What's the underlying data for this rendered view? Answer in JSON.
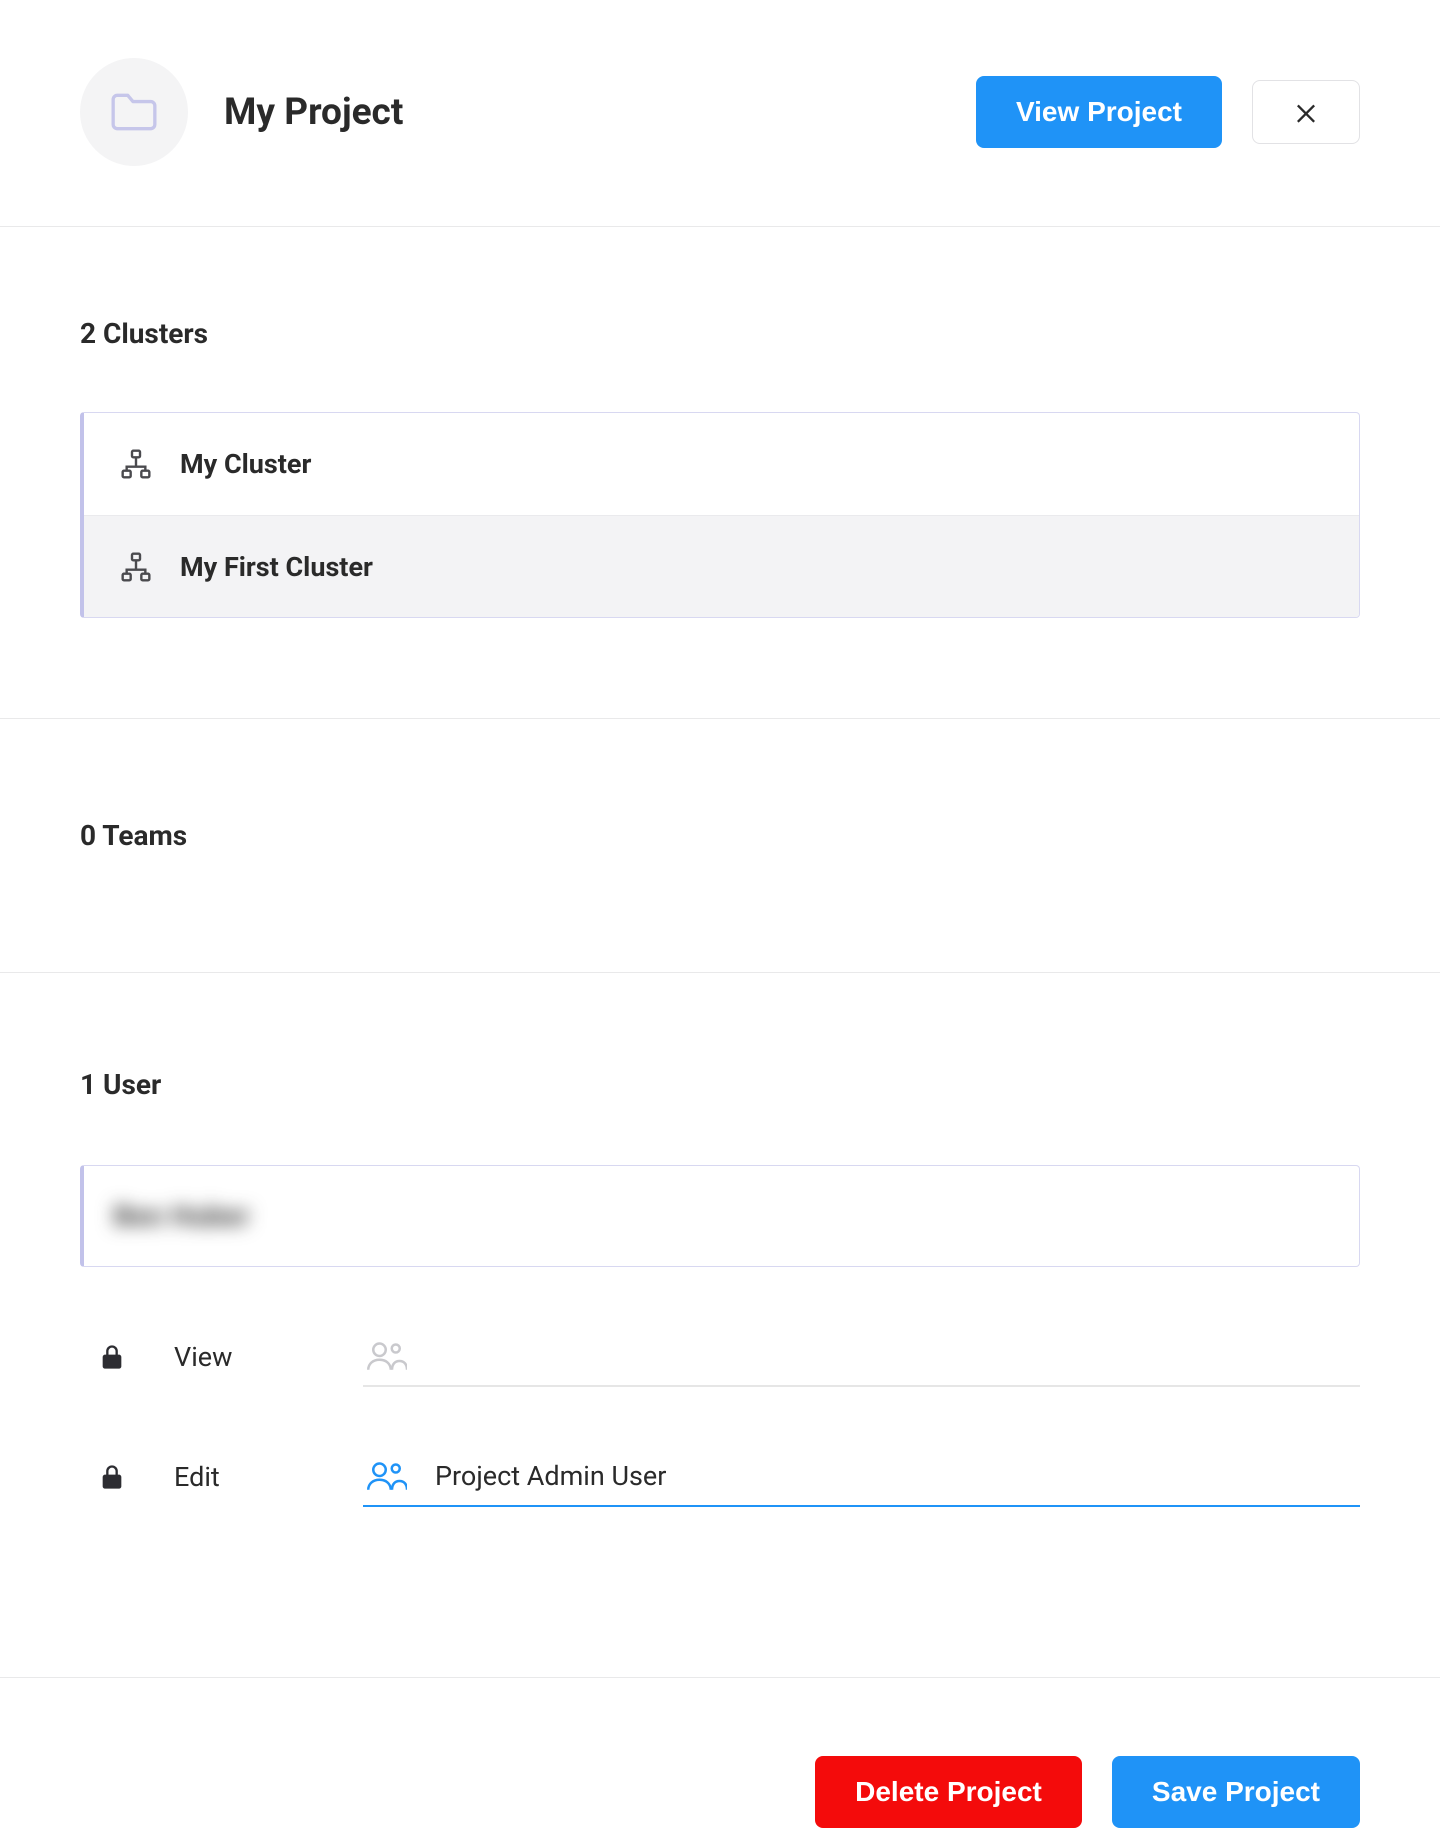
{
  "header": {
    "title": "My Project",
    "view_button": "View Project",
    "close_label": "Close"
  },
  "clusters": {
    "heading": "2 Clusters",
    "items": [
      {
        "name": "My Cluster"
      },
      {
        "name": "My First Cluster"
      }
    ]
  },
  "teams": {
    "heading": "0 Teams"
  },
  "users": {
    "heading": "1 User",
    "selected_user": "Ben Huber",
    "permissions": {
      "view": {
        "label": "View",
        "value": ""
      },
      "edit": {
        "label": "Edit",
        "value": "Project Admin User"
      }
    }
  },
  "footer": {
    "delete_button": "Delete Project",
    "save_button": "Save Project"
  },
  "colors": {
    "primary": "#1f93f7",
    "danger": "#f40b0b",
    "accent_border": "#c2c2ea"
  }
}
